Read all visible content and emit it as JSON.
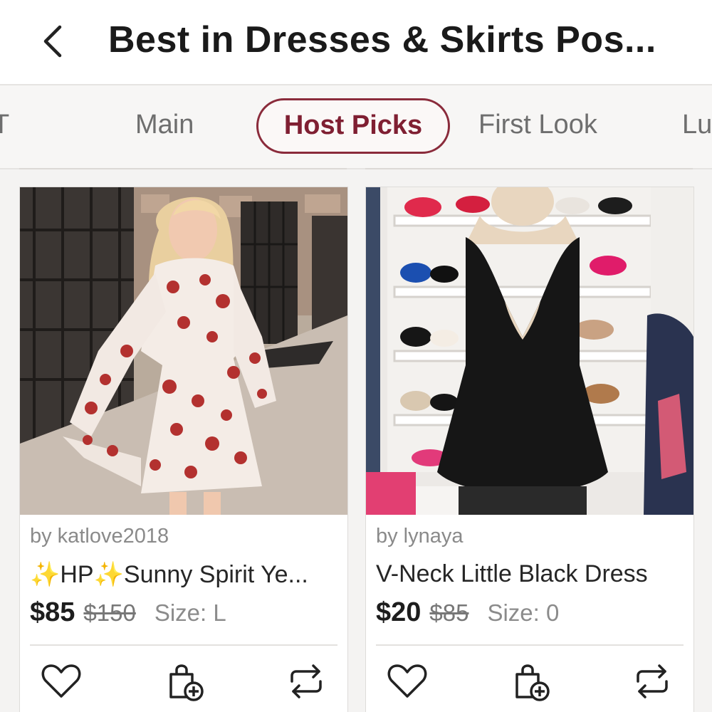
{
  "header": {
    "back_icon": "chevron-left-icon",
    "title": "Best in Dresses & Skirts Pos..."
  },
  "tabs": [
    {
      "label": "T",
      "active": false
    },
    {
      "label": "Main",
      "active": false
    },
    {
      "label": "Host Picks",
      "active": true
    },
    {
      "label": "First Look",
      "active": false
    },
    {
      "label": "Lu",
      "active": false
    }
  ],
  "colors": {
    "accent": "#7f1f32",
    "sparkle": "#f2b51d"
  },
  "listings": [
    {
      "seller": "by katlove2018",
      "title_sparkle_1": "✨",
      "title_hp": "HP",
      "title_sparkle_2": "✨",
      "title_rest": "Sunny Spirit Ye...",
      "price": "$85",
      "original_price": "$150",
      "size": "Size: L",
      "image": "red floral white dress photo",
      "actions": [
        "heart-icon",
        "bundle-add-icon",
        "share-icon"
      ]
    },
    {
      "seller": "by lynaya",
      "title": "V-Neck Little Black Dress",
      "price": "$20",
      "original_price": "$85",
      "size": "Size: 0",
      "image": "black dress on mannequin photo",
      "actions": [
        "heart-icon",
        "bundle-add-icon",
        "share-icon"
      ]
    }
  ]
}
